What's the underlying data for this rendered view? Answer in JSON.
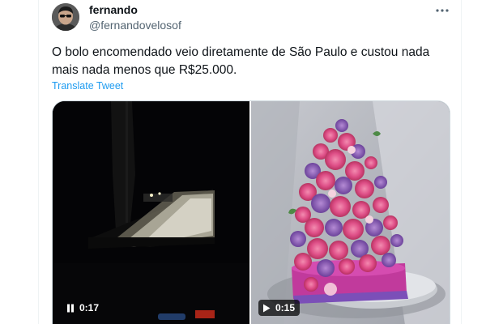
{
  "tweet": {
    "author": {
      "name": "fernando",
      "handle": "@fernandovelosof"
    },
    "text": "O bolo encomendado veio diretamente de São Paulo e custou nada mais nada menos que R$25.000.",
    "translate_label": "Translate Tweet",
    "more_icon": "more-horizontal-icon",
    "media": [
      {
        "kind": "video",
        "state": "paused",
        "icon": "pause-icon",
        "duration": "0:17"
      },
      {
        "kind": "video",
        "state": "play",
        "icon": "play-icon",
        "duration": "0:15"
      }
    ]
  },
  "colors": {
    "text_primary": "#0f1419",
    "text_secondary": "#536471",
    "link": "#1d9bf0",
    "border": "#cfd9de"
  }
}
